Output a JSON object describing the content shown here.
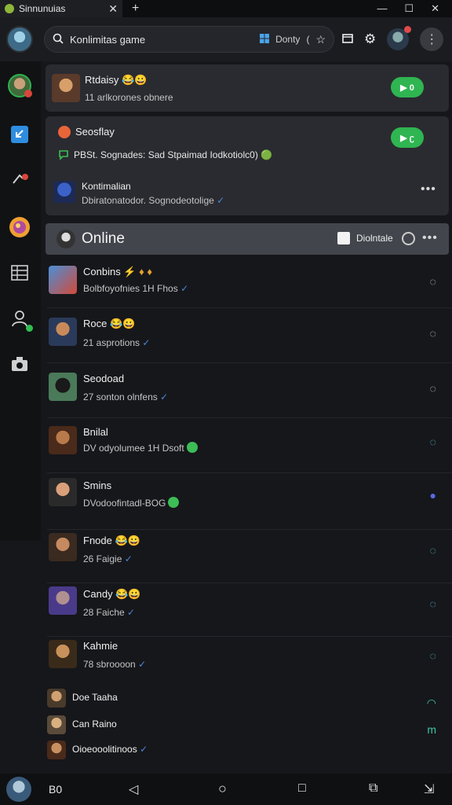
{
  "window": {
    "tab_title": "Sinnunuias",
    "close_glyph": "✕",
    "new_tab_glyph": "+",
    "controls": [
      "—",
      "☐",
      "✕"
    ]
  },
  "header": {
    "search_placeholder": "Konlimitas game",
    "location_label": "Donty",
    "location_sep": "(",
    "icons": [
      "star-icon",
      "window-icon",
      "gear-icon"
    ]
  },
  "rail": {
    "items": [
      "profile",
      "download-icon",
      "notifications-icon",
      "orb-icon",
      "grid-icon",
      "contacts-icon",
      "camera-icon"
    ]
  },
  "cards": [
    {
      "name": "Rtdaisy",
      "name_emoji": "😂😀",
      "sub": "11 arlkorones obnere",
      "action": "▶ 0"
    },
    {
      "name": "Seosflay",
      "message": "PBSt. Sognades: Sad Stpaimad Iodkotiolc0) 🟢",
      "action": "▶ ʗ"
    },
    {
      "name": "Kontimalian",
      "sub": "Dbiratonatodor. Sognodeotolige"
    }
  ],
  "section": {
    "title": "Online",
    "action_label": "Diolntale"
  },
  "contacts": [
    {
      "name": "Conbins",
      "name_extra": "⚡      ♦      ♦",
      "sub": "Bolbfoyofnies 1H Fhos",
      "status": "◌"
    },
    {
      "name": "Roce",
      "name_extra": "😂😀",
      "sub": "21 asprotions",
      "status": "◌"
    },
    {
      "name": "Seodoad",
      "name_extra": "",
      "sub": "27 sonton olnfens",
      "status": "◌"
    },
    {
      "name": "Bnilal",
      "name_extra": "",
      "sub": "DV odyolumee 1H Dsoft",
      "status": "◌"
    },
    {
      "name": "Smins",
      "name_extra": "",
      "sub": "DVodoofintadl-BOG",
      "status": "●"
    },
    {
      "name": "Fnode",
      "name_extra": "😂😀",
      "sub": "26 Faigie",
      "status": "◌"
    },
    {
      "name": "Candy",
      "name_extra": "😂😀",
      "sub": "28 Faiche",
      "status": "◌"
    },
    {
      "name": "Kahmie",
      "name_extra": "",
      "sub": "78 sbroooon",
      "status": "◌"
    },
    {
      "name": "Doe Taaha",
      "name_extra": "",
      "sub": "",
      "status": "◠"
    },
    {
      "name": "Can Raino",
      "name_extra": "",
      "sub": "",
      "status": "m"
    },
    {
      "name": "Oioeooolitinoos",
      "name_extra": "",
      "sub": "",
      "status": ""
    }
  ],
  "navbar": {
    "left_label": "B0",
    "back": "◁",
    "home": "○",
    "recent": "□",
    "extra1": "⧉",
    "extra2": "⇲"
  },
  "colors": {
    "accent_green": "#2fb551",
    "verified_blue": "#4a86d6",
    "background": "#16171b"
  }
}
